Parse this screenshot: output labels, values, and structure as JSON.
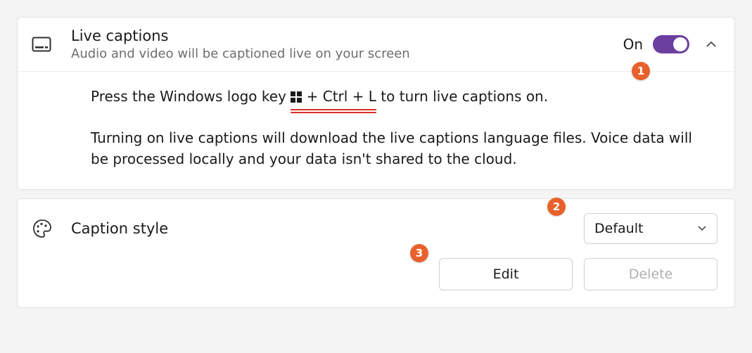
{
  "live_captions": {
    "title": "Live captions",
    "subtitle": "Audio and video will be captioned live on your screen",
    "state_label": "On",
    "shortcut_prefix": "Press the Windows logo key ",
    "shortcut_keys": " + Ctrl + L",
    "shortcut_suffix": " to turn live captions on.",
    "description": "Turning on live captions will download the live captions language files. Voice data will be processed locally and your data isn't shared to the cloud."
  },
  "caption_style": {
    "label": "Caption style",
    "selected": "Default",
    "edit_label": "Edit",
    "delete_label": "Delete"
  },
  "markers": {
    "m1": "1",
    "m2": "2",
    "m3": "3"
  }
}
